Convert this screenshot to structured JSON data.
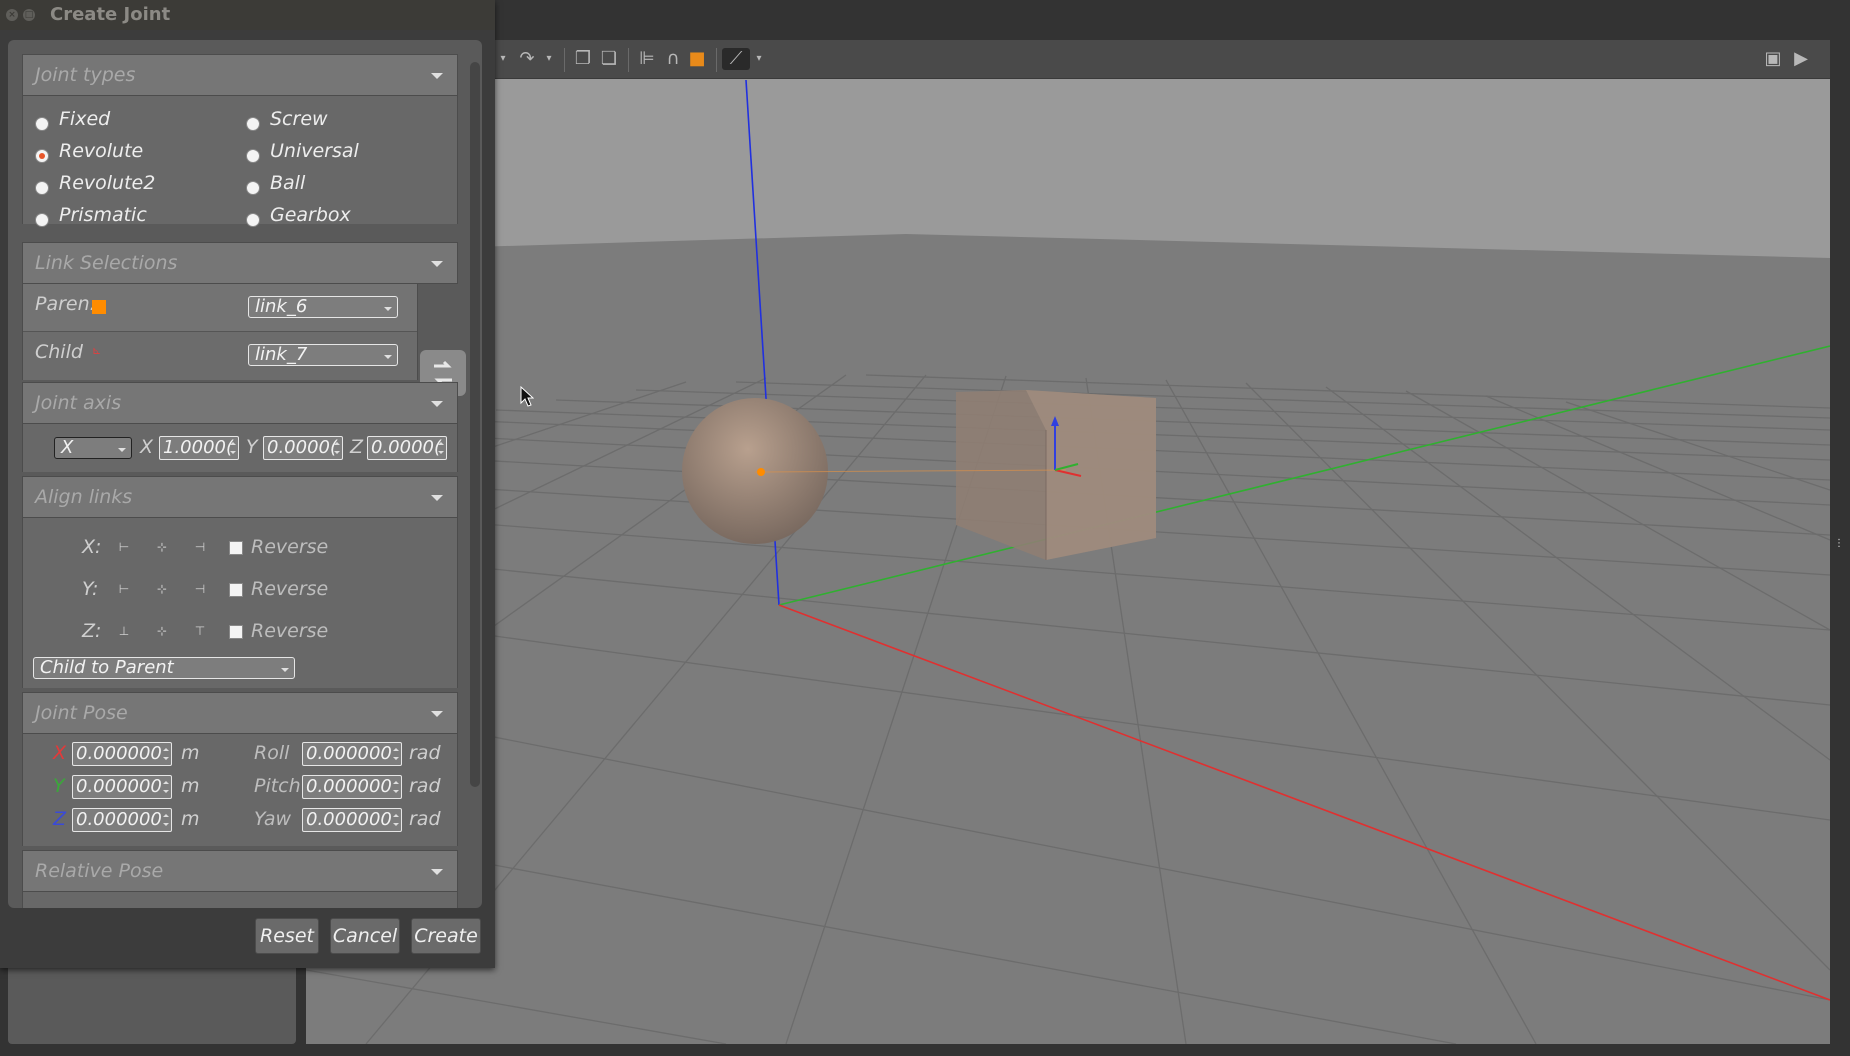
{
  "dialog": {
    "title": "Create Joint"
  },
  "joint_types": {
    "header": "Joint types",
    "options": [
      {
        "label": "Fixed",
        "selected": false
      },
      {
        "label": "Revolute",
        "selected": true
      },
      {
        "label": "Revolute2",
        "selected": false
      },
      {
        "label": "Prismatic",
        "selected": false
      },
      {
        "label": "Screw",
        "selected": false
      },
      {
        "label": "Universal",
        "selected": false
      },
      {
        "label": "Ball",
        "selected": false
      },
      {
        "label": "Gearbox",
        "selected": false
      }
    ]
  },
  "link_selections": {
    "header": "Link Selections",
    "parent_label": "Paren:",
    "parent_value": "link_6",
    "child_label": "Child",
    "child_value": "link_7",
    "parent_color": "#ff8c00"
  },
  "joint_axis": {
    "header": "Joint axis",
    "preset": "X",
    "x_label": "X",
    "x_value": "1.0000(",
    "y_label": "Y",
    "y_value": "0.0000(",
    "z_label": "Z",
    "z_value": "0.0000("
  },
  "align_links": {
    "header": "Align links",
    "x_label": "X:",
    "y_label": "Y:",
    "z_label": "Z:",
    "reverse_label": "Reverse",
    "mode": "Child to Parent"
  },
  "joint_pose": {
    "header": "Joint Pose",
    "x_label": "X",
    "y_label": "Y",
    "z_label": "Z",
    "x_value": "0.000000",
    "y_value": "0.000000",
    "z_value": "0.000000",
    "unit_m": "m",
    "roll_label": "Roll",
    "pitch_label": "Pitch",
    "yaw_label": "Yaw",
    "roll_value": "0.000000",
    "pitch_value": "0.000000",
    "yaw_value": "0.000000",
    "unit_rad": "rad",
    "x_color": "#e23a3a",
    "y_color": "#3aa83a",
    "z_color": "#3a4ad8"
  },
  "relative_pose": {
    "header": "Relative Pose"
  },
  "buttons": {
    "reset": "Reset",
    "cancel": "Cancel",
    "create": "Create"
  },
  "colors": {
    "accent_selected": "#e8562a",
    "axis_x": "#e03030",
    "axis_y": "#30c030",
    "axis_z": "#2030e0"
  }
}
